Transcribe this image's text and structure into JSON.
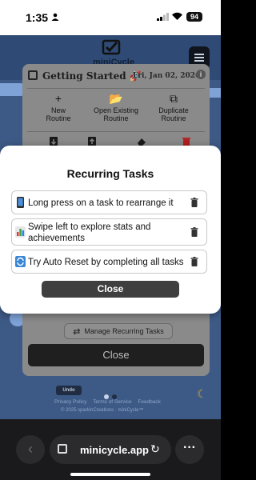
{
  "status_bar": {
    "time": "1:35",
    "battery": "94"
  },
  "app": {
    "logo_text": "miniCycle",
    "panel": {
      "title": "Getting Started 🚀",
      "date": "Fri, Jan 02, 2026",
      "info_glyph": "i",
      "options": [
        {
          "icon": "plus-icon",
          "glyph": "+",
          "label_line1": "New",
          "label_line2": "Routine"
        },
        {
          "icon": "folder-open-icon",
          "glyph": "📂",
          "label_line1": "Open Existing",
          "label_line2": "Routine"
        },
        {
          "icon": "duplicate-icon",
          "glyph": "⧉",
          "label_line1": "Duplicate",
          "label_line2": "Routine"
        }
      ],
      "manage_button": "Manage Recurring Tasks",
      "close_button": "Close"
    },
    "footer": {
      "undo": "Undo",
      "links": [
        "Privacy Policy",
        "Terms of Service",
        "Feedback"
      ],
      "copyright": "© 2025 sparkinCreations · miniCycle™"
    }
  },
  "modal": {
    "title": "Recurring Tasks",
    "tasks": [
      {
        "emoji_icon": "phone-icon",
        "color": "#2d2d2d",
        "line1": "Long press on a task to rearrange it",
        "line2": ""
      },
      {
        "emoji_icon": "bar-chart-icon",
        "color": "#e7e7e7",
        "line1": "Swipe left to explore stats and",
        "line2": "achievements"
      },
      {
        "emoji_icon": "repeat-icon",
        "color": "#3a86d6",
        "line1": "Try Auto Reset by completing all tasks",
        "line2": ""
      }
    ],
    "close_label": "Close"
  },
  "browser": {
    "url": "minicycle.app"
  },
  "colors": {
    "accent": "#3f3f3f",
    "app_bg": "#3d5a86",
    "modal_bg": "#ffffff"
  }
}
